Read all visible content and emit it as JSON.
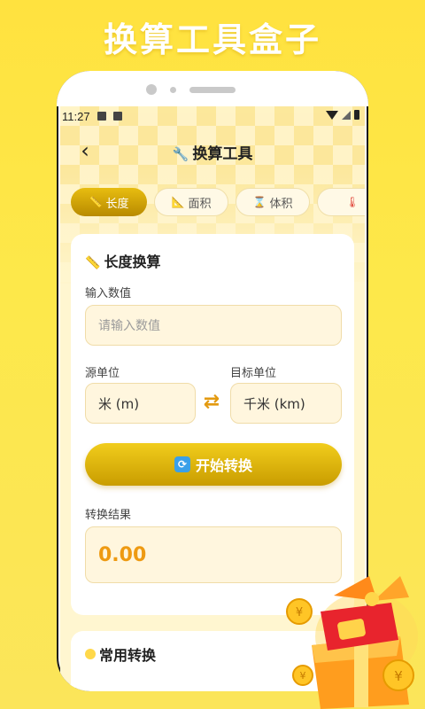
{
  "promo": {
    "title": "换算工具盒子"
  },
  "status": {
    "time": "11:27"
  },
  "nav": {
    "title": "换算工具",
    "title_icon": "wrench-icon",
    "back_icon": "chevron-left-icon"
  },
  "tabs": [
    {
      "label": "长度",
      "icon": "ruler-icon",
      "active": true
    },
    {
      "label": "面积",
      "icon": "triangle-ruler-icon",
      "active": false
    },
    {
      "label": "体积",
      "icon": "cube-icon",
      "active": false
    },
    {
      "label": "",
      "icon": "thermometer-icon",
      "active": false
    }
  ],
  "converter": {
    "title": "长度换算",
    "input_label": "输入数值",
    "input_placeholder": "请输入数值",
    "source_label": "源单位",
    "source_value": "米 (m)",
    "target_label": "目标单位",
    "target_value": "千米 (km)",
    "start_button": "开始转换",
    "result_label": "转换结果",
    "result_value": "0.00"
  },
  "common": {
    "title": "常用转换"
  },
  "colors": {
    "accent": "#e2b40c",
    "result": "#ee9a12",
    "background": "#fde84a"
  }
}
